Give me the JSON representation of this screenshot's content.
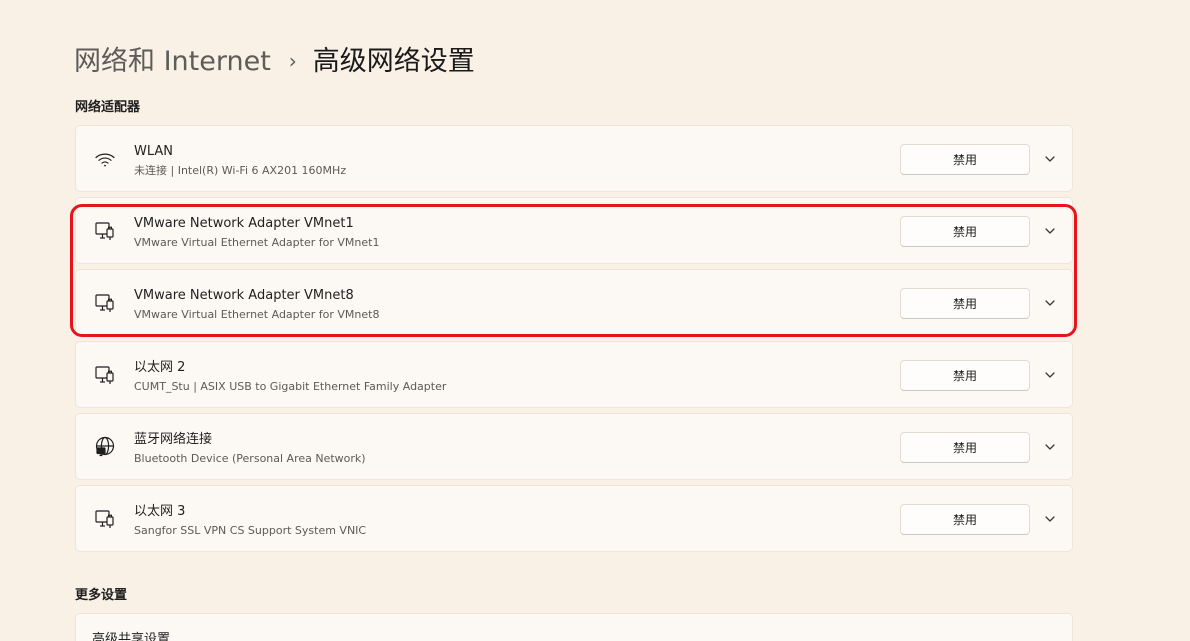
{
  "breadcrumb": {
    "parent": "网络和 Internet",
    "separator": "›",
    "current": "高级网络设置"
  },
  "sections": {
    "adapters_title": "网络适配器",
    "more_title": "更多设置"
  },
  "adapters": [
    {
      "name": "WLAN",
      "description": "未连接 | Intel(R) Wi-Fi 6 AX201 160MHz",
      "icon": "wifi-icon",
      "button_label": "禁用"
    },
    {
      "name": "VMware Network Adapter VMnet1",
      "description": "VMware Virtual Ethernet Adapter for VMnet1",
      "icon": "ethernet-icon",
      "button_label": "禁用"
    },
    {
      "name": "VMware Network Adapter VMnet8",
      "description": "VMware Virtual Ethernet Adapter for VMnet8",
      "icon": "ethernet-icon",
      "button_label": "禁用"
    },
    {
      "name": "以太网 2",
      "description": "CUMT_Stu | ASIX USB to Gigabit Ethernet Family Adapter",
      "icon": "ethernet-icon",
      "button_label": "禁用"
    },
    {
      "name": "蓝牙网络连接",
      "description": "Bluetooth Device (Personal Area Network)",
      "icon": "globe-network-icon",
      "button_label": "禁用"
    },
    {
      "name": "以太网 3",
      "description": "Sangfor SSL VPN CS Support System VNIC",
      "icon": "ethernet-icon",
      "button_label": "禁用"
    }
  ],
  "more_settings": [
    {
      "label": "高级共享设置"
    }
  ],
  "colors": {
    "background": "#f9f1e6",
    "card": "#fcf9f4",
    "highlight": "#e8141c"
  }
}
